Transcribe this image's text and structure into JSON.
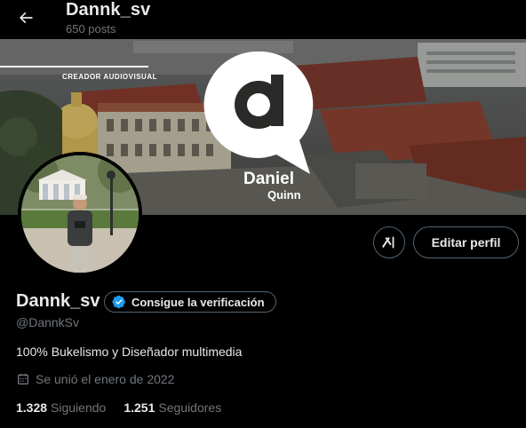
{
  "header": {
    "title": "Dannk_sv",
    "posts_count": "650 posts"
  },
  "banner": {
    "caption": "CREADOR AUDIOVISUAL",
    "logo_first_name": "Daniel",
    "logo_last_name": "Quinn"
  },
  "actions": {
    "edit_profile_label": "Editar perfil"
  },
  "profile": {
    "display_name": "Dannk_sv",
    "verify_label": "Consigue la verificación",
    "handle": "@DannkSv",
    "bio": "100% Bukelismo y Diseñador multimedia",
    "joined": "Se unió el enero de 2022"
  },
  "stats": {
    "following_count": "1.328",
    "following_label": "Siguiendo",
    "followers_count": "1.251",
    "followers_label": "Seguidores"
  },
  "colors": {
    "background": "#000000",
    "text_primary": "#e7e9ea",
    "text_secondary": "#71767b",
    "border": "#536471",
    "verified_blue": "#1d9bf0"
  }
}
